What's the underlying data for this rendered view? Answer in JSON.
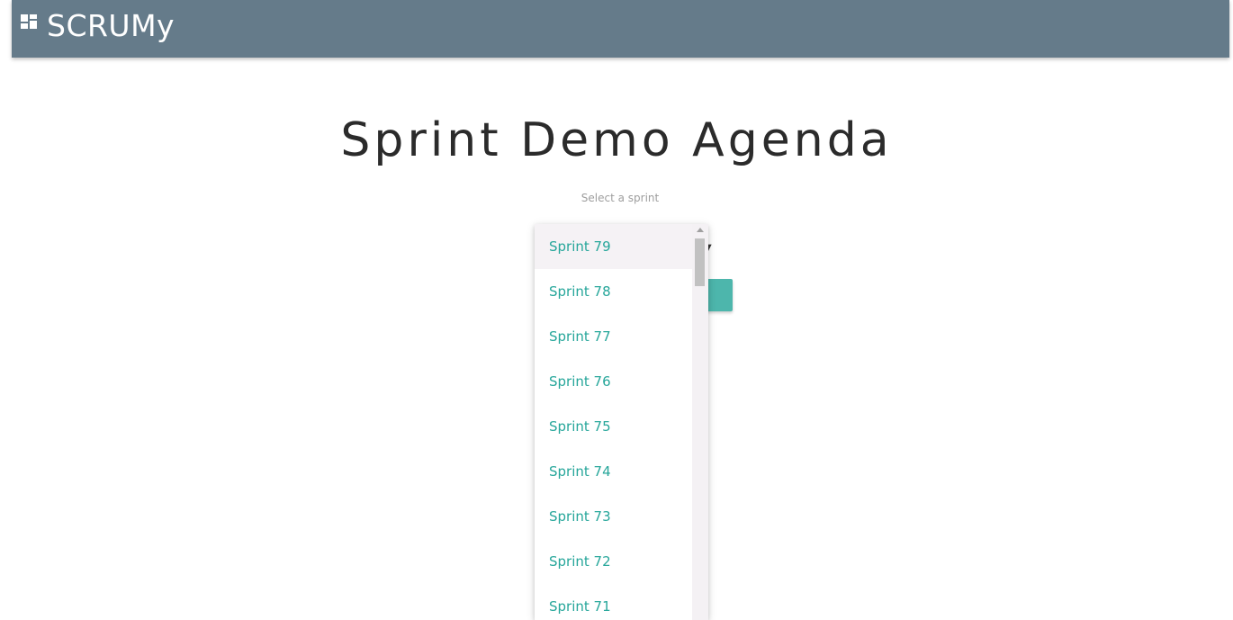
{
  "app": {
    "brand": "SCRUMy"
  },
  "main": {
    "title": "Sprint Demo Agenda",
    "select_label": "Select a sprint"
  },
  "dropdown": {
    "items": [
      {
        "label": "Sprint 79",
        "selected": true
      },
      {
        "label": "Sprint 78"
      },
      {
        "label": "Sprint 77"
      },
      {
        "label": "Sprint 76"
      },
      {
        "label": "Sprint 75"
      },
      {
        "label": "Sprint 74"
      },
      {
        "label": "Sprint 73"
      },
      {
        "label": "Sprint 72"
      },
      {
        "label": "Sprint 71"
      }
    ]
  },
  "colors": {
    "navbar": "#657b8a",
    "accent": "#26a69a",
    "button": "#4db6ac"
  },
  "icons": {
    "logo": "dashboard-grid-icon",
    "select_arrow": "caret-down-icon",
    "scroll_up": "scroll-up-arrow-icon"
  }
}
